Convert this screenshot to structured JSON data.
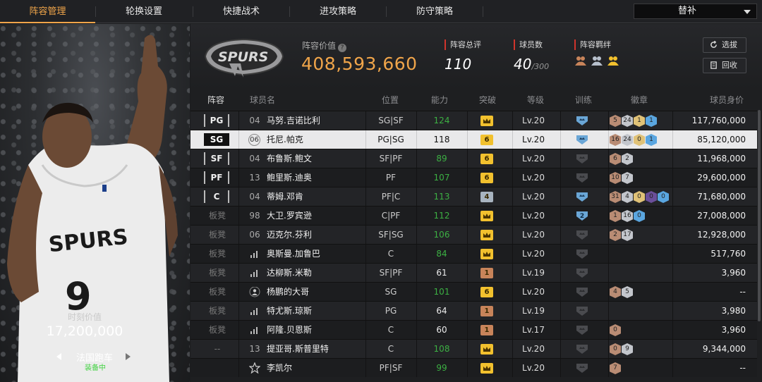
{
  "nav": {
    "tabs": [
      {
        "label": "阵容管理",
        "active": true
      },
      {
        "label": "轮换设置",
        "active": false
      },
      {
        "label": "快捷战术",
        "active": false
      },
      {
        "label": "进攻策略",
        "active": false
      },
      {
        "label": "防守策略",
        "active": false
      }
    ],
    "dropdown_value": "替补"
  },
  "player": {
    "jersey_text": "SPURS",
    "jersey_number": "9",
    "moment_label": "时刻价值",
    "moment_value": "17,200,000",
    "car_name": "法国跑车",
    "car_status": "装备中"
  },
  "header": {
    "logo_text": "SPURS",
    "lineup_value_label": "阵容价值",
    "lineup_value": "408,593,660",
    "rating_label": "阵容总评",
    "rating": "110",
    "count_label": "球员数",
    "count": "40",
    "count_max": "/300",
    "bond_label": "阵容羁绊",
    "bond_icons": [
      "team-bond-bronze-icon",
      "team-bond-silver-icon",
      "team-bond-gold-icon"
    ],
    "btn_select": "选拔",
    "btn_recycle": "回收"
  },
  "columns": [
    "阵容",
    "球员名",
    "位置",
    "能力",
    "突破",
    "等级",
    "训练",
    "徽章",
    "球员身价"
  ],
  "colors": {
    "accent": "#f0a54a",
    "ability_green": "#3cb043",
    "break_gold": "#f2c12e",
    "break_bronze": "#c8845a",
    "break_silver": "#a8b4c0"
  },
  "rows": [
    {
      "slot": "PG",
      "slot_type": "pos",
      "num": "04",
      "num_type": "text",
      "name": "马努.吉诺比利",
      "pos": "SG|SF",
      "ability": "124",
      "ability_green": true,
      "break": "crown",
      "break_color": "gold",
      "lvl": "Lv.20",
      "train": "blue",
      "train_val": "",
      "badges": [
        [
          "5",
          "bronze"
        ],
        [
          "24",
          "silver"
        ],
        [
          "1",
          "gold"
        ],
        [
          "1",
          "blue"
        ]
      ],
      "value": "117,760,000",
      "selected": false
    },
    {
      "slot": "SG",
      "slot_type": "pos",
      "num": "06",
      "num_type": "circle",
      "name": "托尼.帕克",
      "pos": "PG|SG",
      "ability": "118",
      "ability_green": false,
      "break": "6",
      "break_color": "gold",
      "lvl": "Lv.20",
      "train": "blue",
      "train_val": "",
      "badges": [
        [
          "16",
          "bronze"
        ],
        [
          "24",
          "silver"
        ],
        [
          "0",
          "gold"
        ],
        [
          "1",
          "blue"
        ]
      ],
      "value": "85,120,000",
      "selected": true
    },
    {
      "slot": "SF",
      "slot_type": "pos",
      "num": "04",
      "num_type": "text",
      "name": "布鲁斯.鲍文",
      "pos": "SF|PF",
      "ability": "89",
      "ability_green": true,
      "break": "6",
      "break_color": "gold",
      "lvl": "Lv.20",
      "train": "gray",
      "train_val": "",
      "badges": [
        [
          "6",
          "bronze"
        ],
        [
          "2",
          "silver"
        ]
      ],
      "value": "11,968,000",
      "selected": false
    },
    {
      "slot": "PF",
      "slot_type": "pos",
      "num": "13",
      "num_type": "text",
      "name": "鲍里斯.迪奥",
      "pos": "PF",
      "ability": "107",
      "ability_green": true,
      "break": "6",
      "break_color": "gold",
      "lvl": "Lv.20",
      "train": "gray",
      "train_val": "",
      "badges": [
        [
          "10",
          "bronze"
        ],
        [
          "7",
          "silver"
        ]
      ],
      "value": "29,600,000",
      "selected": false
    },
    {
      "slot": "C",
      "slot_type": "pos",
      "num": "04",
      "num_type": "text",
      "name": "蒂姆.邓肯",
      "pos": "PF|C",
      "ability": "113",
      "ability_green": true,
      "break": "4",
      "break_color": "silver",
      "lvl": "Lv.20",
      "train": "blue",
      "train_val": "",
      "badges": [
        [
          "31",
          "bronze"
        ],
        [
          "4",
          "silver"
        ],
        [
          "0",
          "gold"
        ],
        [
          "0",
          "purple"
        ],
        [
          "0",
          "blue"
        ]
      ],
      "value": "71,680,000",
      "selected": false
    },
    {
      "slot": "板凳",
      "slot_type": "bench",
      "num": "98",
      "num_type": "text",
      "name": "大卫.罗宾逊",
      "pos": "C|PF",
      "ability": "112",
      "ability_green": true,
      "break": "crown",
      "break_color": "gold",
      "lvl": "Lv.20",
      "train": "blue",
      "train_val": "2",
      "badges": [
        [
          "1",
          "bronze"
        ],
        [
          "16",
          "silver"
        ],
        [
          "0",
          "blue"
        ]
      ],
      "value": "27,008,000",
      "selected": false
    },
    {
      "slot": "板凳",
      "slot_type": "bench",
      "num": "06",
      "num_type": "text",
      "name": "迈克尔.芬利",
      "pos": "SF|SG",
      "ability": "106",
      "ability_green": true,
      "break": "crown",
      "break_color": "gold",
      "lvl": "Lv.20",
      "train": "gray",
      "train_val": "",
      "badges": [
        [
          "2",
          "bronze"
        ],
        [
          "17",
          "silver"
        ]
      ],
      "value": "12,928,000",
      "selected": false
    },
    {
      "slot": "板凳",
      "slot_type": "bench",
      "num": "",
      "num_type": "signal",
      "name": "奥斯曼.加鲁巴",
      "pos": "C",
      "ability": "84",
      "ability_green": true,
      "break": "crown",
      "break_color": "gold",
      "lvl": "Lv.20",
      "train": "gray",
      "train_val": "",
      "badges": [],
      "value": "517,760",
      "selected": false
    },
    {
      "slot": "板凳",
      "slot_type": "bench",
      "num": "",
      "num_type": "signal",
      "name": "达柳斯.米勒",
      "pos": "SF|PF",
      "ability": "61",
      "ability_green": false,
      "break": "1",
      "break_color": "bronze",
      "lvl": "Lv.19",
      "train": "gray",
      "train_val": "",
      "badges": [],
      "value": "3,960",
      "selected": false
    },
    {
      "slot": "板凳",
      "slot_type": "bench",
      "num": "",
      "num_type": "person",
      "name": "杨鹏的大哥",
      "pos": "SG",
      "ability": "101",
      "ability_green": true,
      "break": "6",
      "break_color": "gold",
      "lvl": "Lv.20",
      "train": "gray",
      "train_val": "",
      "badges": [
        [
          "4",
          "bronze"
        ],
        [
          "5",
          "silver"
        ]
      ],
      "value": "--",
      "selected": false
    },
    {
      "slot": "板凳",
      "slot_type": "bench",
      "num": "",
      "num_type": "signal",
      "name": "特尤斯.琼斯",
      "pos": "PG",
      "ability": "64",
      "ability_green": false,
      "break": "1",
      "break_color": "bronze",
      "lvl": "Lv.19",
      "train": "gray",
      "train_val": "",
      "badges": [],
      "value": "3,980",
      "selected": false
    },
    {
      "slot": "板凳",
      "slot_type": "bench",
      "num": "",
      "num_type": "signal",
      "name": "阿隆.贝恩斯",
      "pos": "C",
      "ability": "60",
      "ability_green": false,
      "break": "1",
      "break_color": "bronze",
      "lvl": "Lv.17",
      "train": "gray",
      "train_val": "",
      "badges": [
        [
          "0",
          "bronze"
        ]
      ],
      "value": "3,960",
      "selected": false
    },
    {
      "slot": "--",
      "slot_type": "bench",
      "num": "13",
      "num_type": "text",
      "name": "提亚哥.斯普里特",
      "pos": "C",
      "ability": "108",
      "ability_green": true,
      "break": "crown",
      "break_color": "gold",
      "lvl": "Lv.20",
      "train": "gray",
      "train_val": "",
      "badges": [
        [
          "0",
          "bronze"
        ],
        [
          "9",
          "silver"
        ]
      ],
      "value": "9,344,000",
      "selected": false
    },
    {
      "slot": "",
      "slot_type": "bench",
      "num": "",
      "num_type": "star",
      "name": "李凯尔",
      "pos": "PF|SF",
      "ability": "99",
      "ability_green": true,
      "break": "crown",
      "break_color": "gold",
      "lvl": "Lv.20",
      "train": "gray",
      "train_val": "",
      "badges": [
        [
          "7",
          "bronze"
        ]
      ],
      "value": "--",
      "selected": false
    }
  ]
}
